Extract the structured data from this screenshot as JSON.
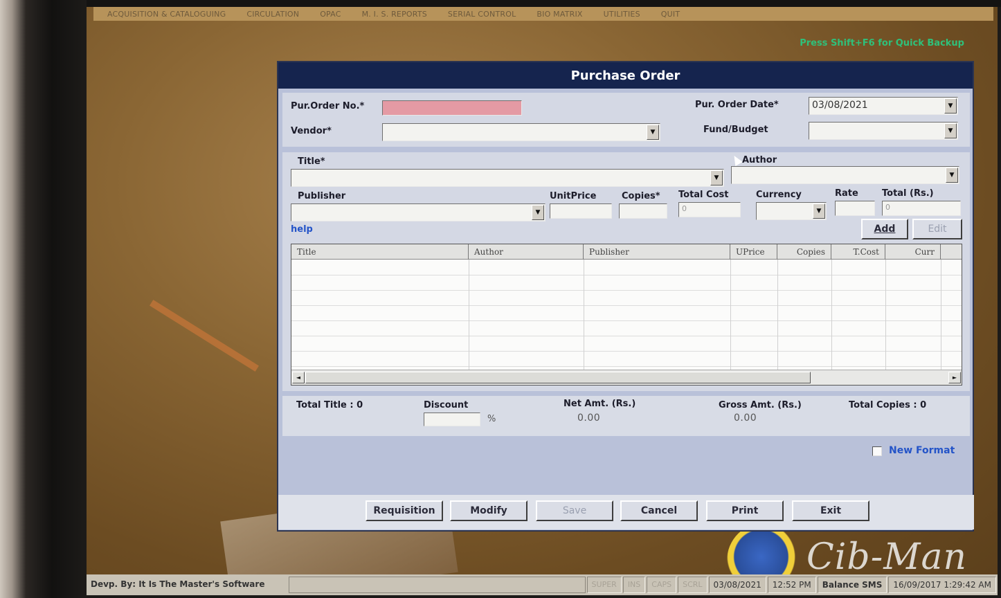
{
  "menubar": {
    "items": [
      {
        "label": "ACQUISITION & CATALOGUING"
      },
      {
        "label": "CIRCULATION"
      },
      {
        "label": "OPAC"
      },
      {
        "label": "M. I. S. REPORTS"
      },
      {
        "label": "SERIAL CONTROL"
      },
      {
        "label": "BIO MATRIX"
      },
      {
        "label": "UTILITIES"
      },
      {
        "label": "QUIT"
      }
    ]
  },
  "backup_hint": "Press Shift+F6 for Quick Backup",
  "window": {
    "title": "Purchase Order"
  },
  "header_form": {
    "po_no_label": "Pur.Order No.*",
    "po_no_value": "",
    "po_date_label": "Pur. Order Date*",
    "po_date_value": "03/08/2021",
    "vendor_label": "Vendor*",
    "vendor_value": "",
    "fund_label": "Fund/Budget",
    "fund_value": ""
  },
  "item_form": {
    "title_label": "Title*",
    "author_label": "Author",
    "publisher_label": "Publisher",
    "unit_price_label": "UnitPrice",
    "copies_label": "Copies*",
    "total_cost_label": "Total Cost",
    "total_cost_value": "0",
    "currency_label": "Currency",
    "rate_label": "Rate",
    "total_rs_label": "Total (Rs.)",
    "total_rs_value": "0",
    "help_link": "help",
    "add_button": "Add",
    "edit_button": "Edit"
  },
  "grid": {
    "columns": [
      "Title",
      "Author",
      "Publisher",
      "UPrice",
      "Copies",
      "T.Cost",
      "Curr"
    ],
    "rows": []
  },
  "summary": {
    "total_title": "Total Title : 0",
    "discount_label": "Discount",
    "discount_value": "",
    "percent_sign": "%",
    "net_amt_label": "Net Amt. (Rs.)",
    "net_amt_value": "0.00",
    "gross_amt_label": "Gross Amt. (Rs.)",
    "gross_amt_value": "0.00",
    "total_copies": "Total Copies : 0"
  },
  "new_format": {
    "label": "New Format",
    "checked": false
  },
  "actions": {
    "requisition": "Requisition",
    "modify": "Modify",
    "save": "Save",
    "cancel": "Cancel",
    "print": "Print",
    "exit": "Exit"
  },
  "statusbar": {
    "developer": "Devp. By: It Is The Master's Software",
    "super": "SUPER",
    "ins": "INS",
    "caps": "CAPS",
    "scrl": "SCRL",
    "date": "03/08/2021",
    "time": "12:52 PM",
    "balance": "Balance SMS",
    "datetime": "16/09/2017 1:29:42 AM"
  },
  "logo": {
    "text": "Cib-Man"
  }
}
